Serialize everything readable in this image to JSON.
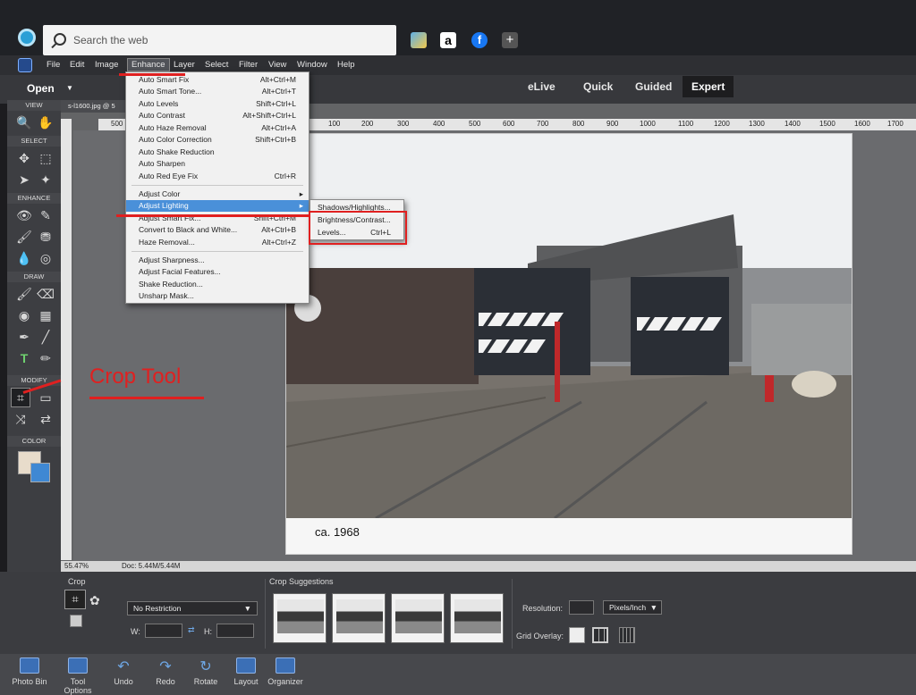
{
  "taskbar": {
    "search_placeholder": "Search the web"
  },
  "menubar": {
    "items": [
      "File",
      "Edit",
      "Image",
      "Enhance",
      "Layer",
      "Select",
      "Filter",
      "View",
      "Window",
      "Help"
    ],
    "active": "Enhance"
  },
  "modebar": {
    "open_label": "Open",
    "modes": [
      "eLive",
      "Quick",
      "Guided",
      "Expert"
    ],
    "active_mode": "Expert"
  },
  "toolbox": {
    "sections": [
      "VIEW",
      "SELECT",
      "ENHANCE",
      "DRAW",
      "MODIFY",
      "COLOR"
    ]
  },
  "document": {
    "tab_title": "s-l1600.jpg @ 5",
    "ruler_ticks": [
      "500",
      "100",
      "200",
      "300",
      "400",
      "500",
      "600",
      "700",
      "800",
      "900",
      "1000",
      "1100",
      "1200",
      "1300",
      "1400",
      "1500",
      "1600",
      "1700"
    ],
    "caption": "ca. 1968",
    "zoom": "55.47%",
    "doc_size": "Doc: 5.44M/5.44M"
  },
  "enhance_menu": {
    "items": [
      {
        "label": "Auto Smart Fix",
        "shortcut": "Alt+Ctrl+M"
      },
      {
        "label": "Auto Smart Tone...",
        "shortcut": "Alt+Ctrl+T"
      },
      {
        "label": "Auto Levels",
        "shortcut": "Shift+Ctrl+L"
      },
      {
        "label": "Auto Contrast",
        "shortcut": "Alt+Shift+Ctrl+L"
      },
      {
        "label": "Auto Haze Removal",
        "shortcut": "Alt+Ctrl+A"
      },
      {
        "label": "Auto Color Correction",
        "shortcut": "Shift+Ctrl+B"
      },
      {
        "label": "Auto Shake Reduction",
        "shortcut": ""
      },
      {
        "label": "Auto Sharpen",
        "shortcut": ""
      },
      {
        "label": "Auto Red Eye Fix",
        "shortcut": "Ctrl+R"
      },
      {
        "label": "Adjust Color",
        "shortcut": ""
      },
      {
        "label": "Adjust Lighting",
        "shortcut": ""
      },
      {
        "label": "Adjust Smart Fix...",
        "shortcut": "Shift+Ctrl+M"
      },
      {
        "label": "Convert to Black and White...",
        "shortcut": "Alt+Ctrl+B"
      },
      {
        "label": "Haze Removal...",
        "shortcut": "Alt+Ctrl+Z"
      },
      {
        "label": "Adjust Sharpness...",
        "shortcut": ""
      },
      {
        "label": "Adjust Facial Features...",
        "shortcut": ""
      },
      {
        "label": "Shake Reduction...",
        "shortcut": ""
      },
      {
        "label": "Unsharp Mask...",
        "shortcut": ""
      }
    ],
    "highlighted": "Adjust Lighting"
  },
  "lighting_submenu": {
    "items": [
      {
        "label": "Shadows/Highlights...",
        "shortcut": ""
      },
      {
        "label": "Brightness/Contrast...",
        "shortcut": ""
      },
      {
        "label": "Levels...",
        "shortcut": "Ctrl+L"
      }
    ]
  },
  "annotation": {
    "crop_label": "Crop Tool",
    "color": "#e02020"
  },
  "tool_options": {
    "tool_name": "Crop",
    "restriction": "No Restriction",
    "width_label": "W:",
    "height_label": "H:",
    "crop_suggestions_label": "Crop Suggestions",
    "resolution_label": "Resolution:",
    "resolution_unit": "Pixels/Inch",
    "grid_overlay_label": "Grid Overlay:"
  },
  "bottombar": {
    "buttons": [
      "Photo Bin",
      "Tool Options",
      "Undo",
      "Redo",
      "Rotate",
      "Layout",
      "Organizer"
    ]
  }
}
